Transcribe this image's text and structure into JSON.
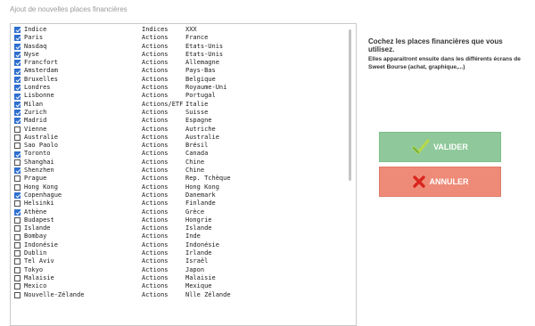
{
  "dialog": {
    "title": "Ajout de nouvelles places financières"
  },
  "instructions": {
    "line1": "Cochez les places financières que vous utilisez.",
    "line2": "Elles apparaitront ensuite dans les différents écrans de Sweet Bourse (achat, graphique,...)"
  },
  "buttons": {
    "validate": "VALIDER",
    "cancel": "ANNULER"
  },
  "colors": {
    "checkbox_on": "#2f6fd0",
    "validate_bg": "#8fc99b",
    "cancel_bg": "#ee8b78"
  },
  "rows": [
    {
      "name": "Indice",
      "type": "Indices",
      "country": "XXX",
      "checked": true
    },
    {
      "name": "Paris",
      "type": "Actions",
      "country": "France",
      "checked": true
    },
    {
      "name": "Nasdaq",
      "type": "Actions",
      "country": "Etats-Unis",
      "checked": true
    },
    {
      "name": "Nyse",
      "type": "Actions",
      "country": "Etats-Unis",
      "checked": true
    },
    {
      "name": "Francfort",
      "type": "Actions",
      "country": "Allemagne",
      "checked": true
    },
    {
      "name": "Amsterdam",
      "type": "Actions",
      "country": "Pays-Bas",
      "checked": true
    },
    {
      "name": "Bruxelles",
      "type": "Actions",
      "country": "Belgique",
      "checked": true
    },
    {
      "name": "Londres",
      "type": "Actions",
      "country": "Royaume-Uni",
      "checked": true
    },
    {
      "name": "Lisbonne",
      "type": "Actions",
      "country": "Portugal",
      "checked": true
    },
    {
      "name": "Milan",
      "type": "Actions/ETF",
      "country": "Italie",
      "checked": true
    },
    {
      "name": "Zurich",
      "type": "Actions",
      "country": "Suisse",
      "checked": true
    },
    {
      "name": "Madrid",
      "type": "Actions",
      "country": "Espagne",
      "checked": true
    },
    {
      "name": "Vienne",
      "type": "Actions",
      "country": "Autriche",
      "checked": false
    },
    {
      "name": "Australie",
      "type": "Actions",
      "country": "Australie",
      "checked": false
    },
    {
      "name": "Sao Paolo",
      "type": "Actions",
      "country": "Brésil",
      "checked": false
    },
    {
      "name": "Toronto",
      "type": "Actions",
      "country": "Canada",
      "checked": true
    },
    {
      "name": "Shanghai",
      "type": "Actions",
      "country": "Chine",
      "checked": false
    },
    {
      "name": "Shenzhen",
      "type": "Actions",
      "country": "Chine",
      "checked": true
    },
    {
      "name": "Prague",
      "type": "Actions",
      "country": "Rep. Tchèque",
      "checked": false
    },
    {
      "name": "Hong Kong",
      "type": "Actions",
      "country": "Hong Kong",
      "checked": false
    },
    {
      "name": "Copenhague",
      "type": "Actions",
      "country": "Danemark",
      "checked": true
    },
    {
      "name": "Helsinki",
      "type": "Actions",
      "country": "Finlande",
      "checked": false
    },
    {
      "name": "Athène",
      "type": "Actions",
      "country": "Grèce",
      "checked": true
    },
    {
      "name": "Budapest",
      "type": "Actions",
      "country": "Hongrie",
      "checked": false
    },
    {
      "name": "Islande",
      "type": "Actions",
      "country": "Islande",
      "checked": false
    },
    {
      "name": "Bombay",
      "type": "Actions",
      "country": "Inde",
      "checked": false
    },
    {
      "name": "Indonésie",
      "type": "Actions",
      "country": "Indonésie",
      "checked": false
    },
    {
      "name": "Dublin",
      "type": "Actions",
      "country": "Irlande",
      "checked": false
    },
    {
      "name": "Tel Aviv",
      "type": "Actions",
      "country": "Israël",
      "checked": false
    },
    {
      "name": "Tokyo",
      "type": "Actions",
      "country": "Japon",
      "checked": false
    },
    {
      "name": "Malaisie",
      "type": "Actions",
      "country": "Malaisie",
      "checked": false
    },
    {
      "name": "Mexico",
      "type": "Actions",
      "country": "Mexique",
      "checked": false
    },
    {
      "name": "Nouvelle-Zélande",
      "type": "Actions",
      "country": "Nlle Zélande",
      "checked": false
    }
  ]
}
